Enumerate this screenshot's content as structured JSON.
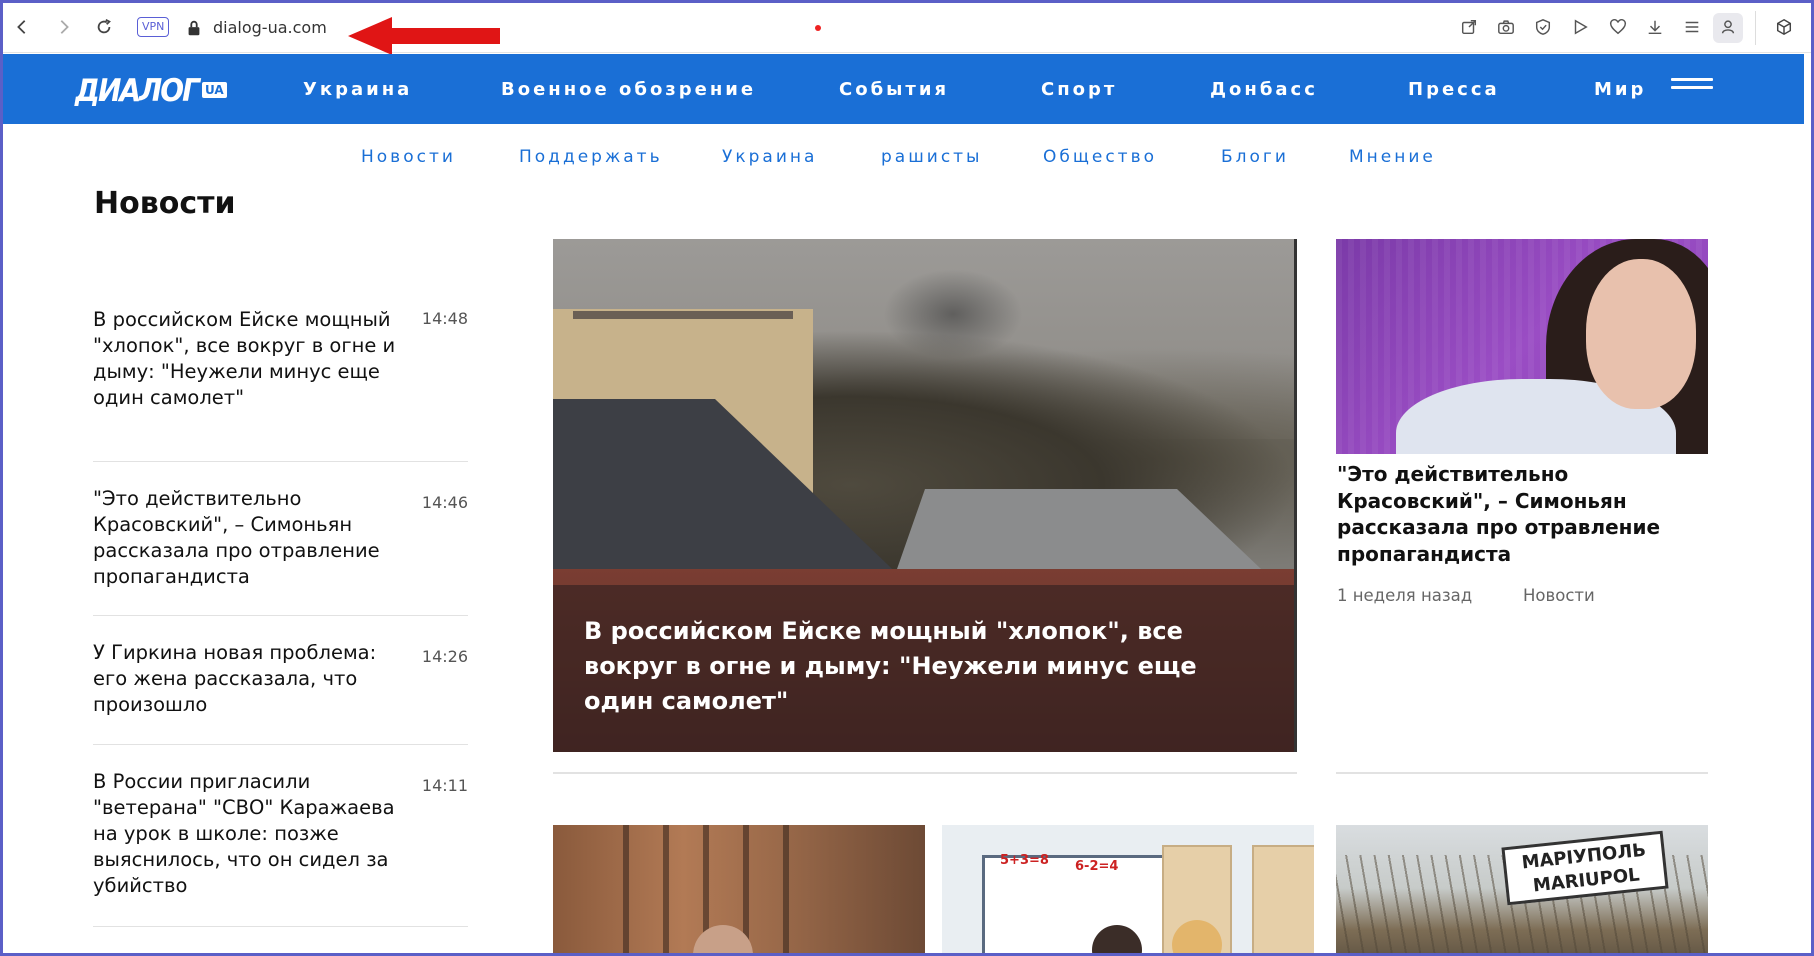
{
  "browser": {
    "vpn_label": "VPN",
    "url": "dialog-ua.com"
  },
  "site": {
    "logo_text": "ДИАЛОГ",
    "logo_badge": "UA",
    "main_nav": [
      "Украина",
      "Военное обозрение",
      "События",
      "Спорт",
      "Донбасс",
      "Пресса",
      "Мир"
    ],
    "sub_nav": [
      "Новости",
      "Поддержать",
      "Украина",
      "рашисты",
      "Общество",
      "Блоги",
      "Мнение"
    ],
    "brand_color": "#1a6fd6"
  },
  "news": {
    "section_title": "Новости",
    "items": [
      {
        "headline": "В российском Ейске мощный \"хлопок\", все вокруг в огне и дыму: \"Неужели минус еще один самолет\"",
        "time": "14:48"
      },
      {
        "headline": "\"Это действительно Красовский\", – Симоньян рассказала про отравление пропагандиста",
        "time": "14:46"
      },
      {
        "headline": "У Гиркина новая проблема: его жена рассказала, что произошло",
        "time": "14:26"
      },
      {
        "headline": "В России пригласили \"ветерана\" \"СВО\" Каражаева на урок в школе: позже выяснилось, что он сидел за убийство",
        "time": "14:11"
      }
    ]
  },
  "featured": {
    "title": "В российском Ейске мощный \"хлопок\", все вокруг в огне и дыму: \"Неужели минус еще один самолет\""
  },
  "side_feature": {
    "title": "\"Это действительно Красовский\", – Симоньян рассказала про отравление пропагандиста",
    "age": "1 неделя назад",
    "category": "Новости"
  },
  "thumbs": {
    "classroom_label_1": "5+3=8",
    "classroom_label_2": "6-2=4",
    "sign_line1": "МАРІУПОЛЬ",
    "sign_line2": "MARIUPOL"
  }
}
